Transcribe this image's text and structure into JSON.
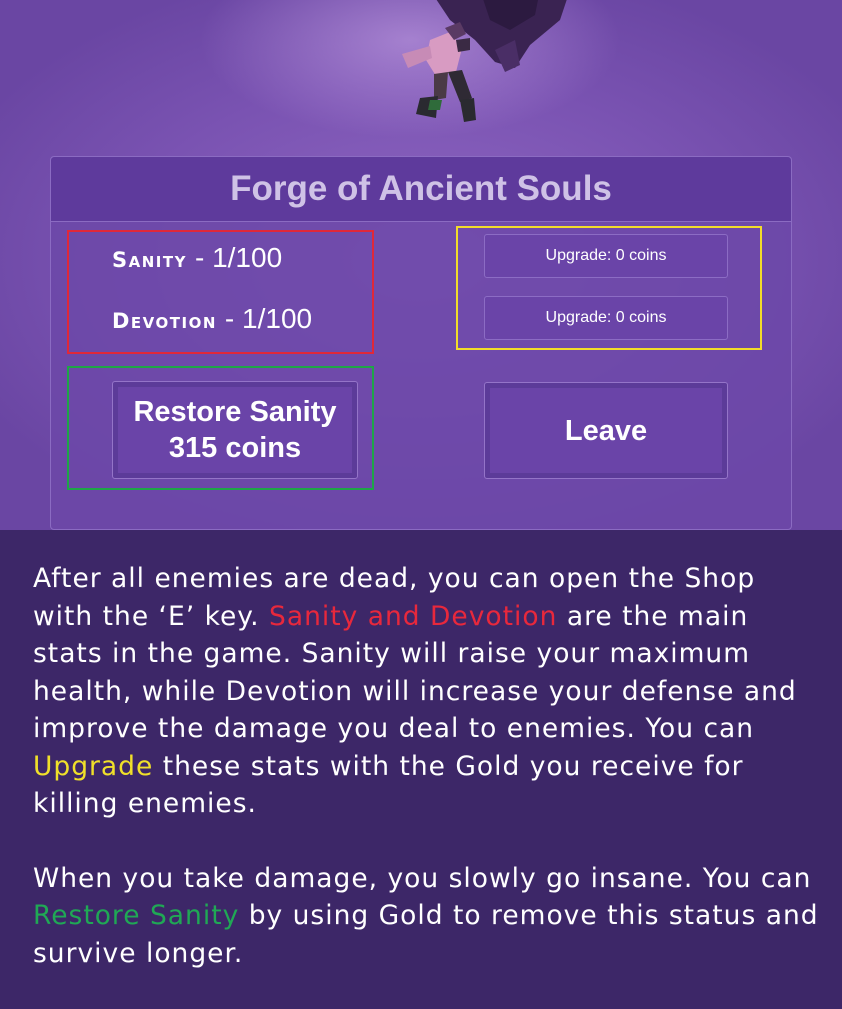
{
  "panel": {
    "title": "Forge of Ancient Souls"
  },
  "stats": {
    "sanity": {
      "name": "Sanity",
      "separator": "-",
      "value": "1/100"
    },
    "devotion": {
      "name": "Devotion",
      "separator": "-",
      "value": "1/100"
    }
  },
  "upgrades": {
    "sanity_label": "Upgrade: 0 coins",
    "devotion_label": "Upgrade: 0 coins"
  },
  "buttons": {
    "restore_line1": "Restore Sanity",
    "restore_line2": "315 coins",
    "leave_label": "Leave"
  },
  "colors": {
    "background": "#3d2768",
    "panel": "#6c48a8",
    "stats_box": "#e0283a",
    "upgrade_box": "#f2dc2a",
    "restore_box": "#1fa548"
  },
  "description": {
    "p1_a": "After all enemies are dead, you can open the Shop with the ‘E’ key. ",
    "p1_highlight1": "Sanity and Devotion",
    "p1_b": " are the main stats in the game. Sanity will raise your maximum health, while Devotion will increase your defense and improve the damage you deal to enemies. You can ",
    "p1_highlight2": "Upgrade",
    "p1_c": " these stats with the Gold you receive for killing enemies.",
    "p2_a": "When you take damage, you slowly go insane. You can ",
    "p2_highlight": "Restore Sanity",
    "p2_b": " by using Gold to remove this status and survive longer."
  }
}
